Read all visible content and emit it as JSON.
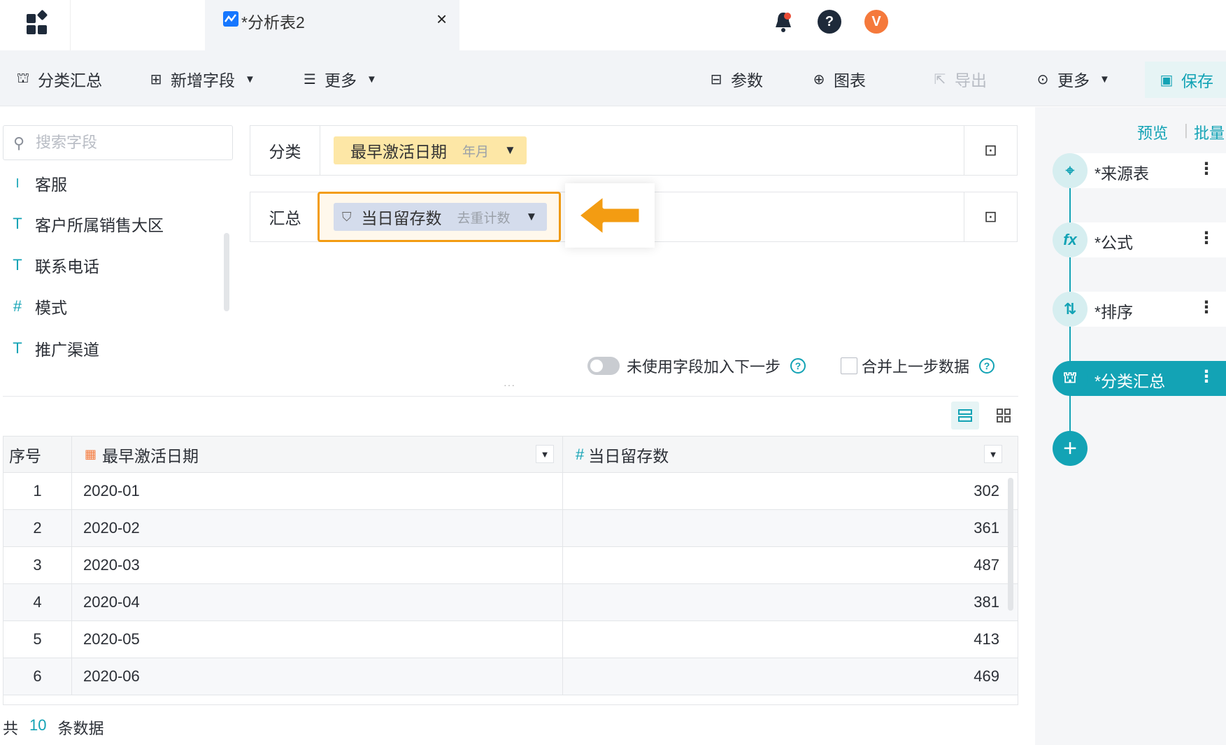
{
  "tab": {
    "title": "*分析表2",
    "close": "×"
  },
  "header_right": {
    "avatar_letter": "V"
  },
  "toolbar": {
    "group_summary": "分类汇总",
    "add_field": "新增字段",
    "more_left": "更多",
    "params": "参数",
    "chart": "图表",
    "export": "导出",
    "more_right": "更多",
    "save": "保存"
  },
  "search": {
    "placeholder": "搜索字段"
  },
  "fields": [
    {
      "type": "I",
      "label": "客服"
    },
    {
      "type": "T",
      "label": "客户所属销售大区"
    },
    {
      "type": "T",
      "label": "联系电话"
    },
    {
      "type": "#",
      "label": "模式"
    },
    {
      "type": "T",
      "label": "推广渠道"
    }
  ],
  "config": {
    "category_label": "分类",
    "category_field": "最早激活日期",
    "category_sub": "年月",
    "summary_label": "汇总",
    "summary_field": "当日留存数",
    "summary_sub": "去重计数",
    "opt_unused": "未使用字段加入下一步",
    "opt_merge": "合并上一步数据"
  },
  "table": {
    "headers": [
      "序号",
      "最早激活日期",
      "当日留存数"
    ],
    "rows": [
      [
        "1",
        "2020-01",
        "302"
      ],
      [
        "2",
        "2020-02",
        "361"
      ],
      [
        "3",
        "2020-03",
        "487"
      ],
      [
        "4",
        "2020-04",
        "381"
      ],
      [
        "5",
        "2020-05",
        "413"
      ],
      [
        "6",
        "2020-06",
        "469"
      ]
    ]
  },
  "footer": {
    "prefix": "共",
    "count": "10",
    "suffix": "条数据"
  },
  "pipeline": {
    "preview": "预览",
    "batch": "批量",
    "steps": [
      {
        "icon": "target-icon",
        "label": "*来源表"
      },
      {
        "icon": "fx-icon",
        "label": "*公式"
      },
      {
        "icon": "sort-icon",
        "label": "*排序"
      },
      {
        "icon": "group-icon",
        "label": "*分类汇总"
      }
    ]
  },
  "colors": {
    "accent": "#13a3b5",
    "highlight": "#f39c12",
    "category_chip": "#fde7a6",
    "summary_chip": "#d4dcec"
  }
}
